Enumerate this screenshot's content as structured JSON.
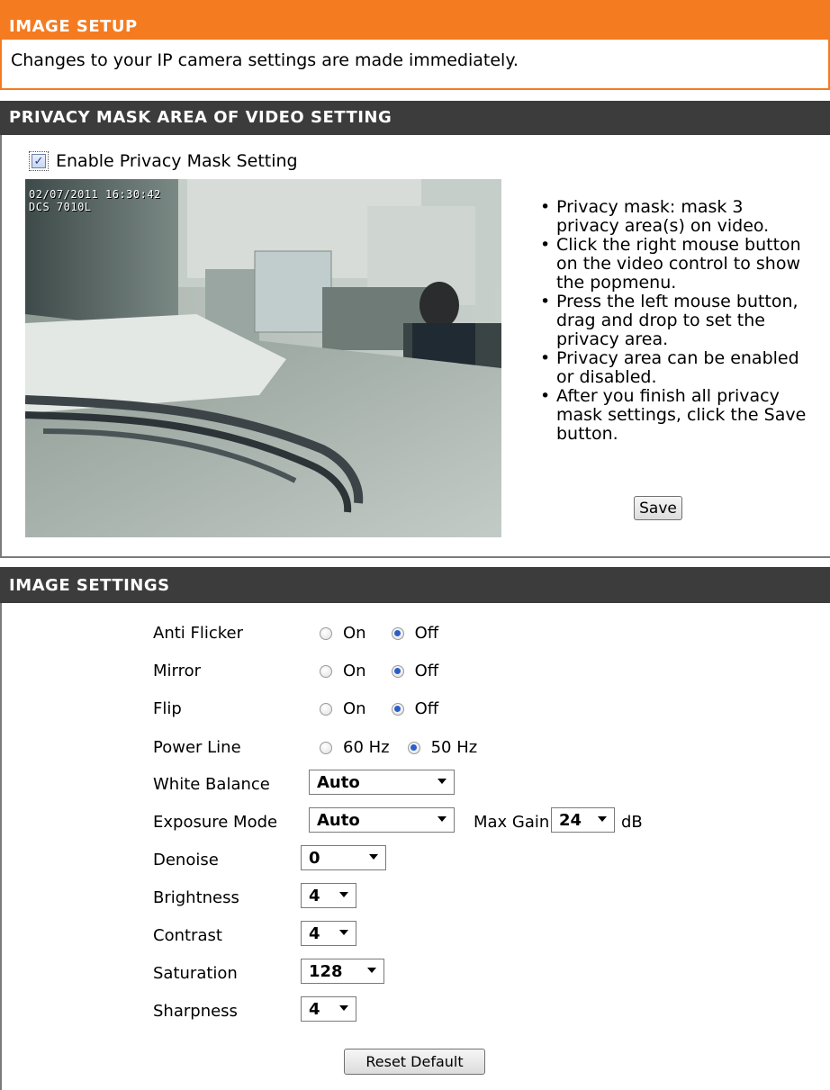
{
  "image_setup": {
    "title": "IMAGE SETUP",
    "description": "Changes to your IP camera settings are made immediately."
  },
  "privacy": {
    "title": "PRIVACY MASK AREA OF VIDEO SETTING",
    "enable_label": "Enable Privacy Mask Setting",
    "enable_checked": true,
    "osd_line1": "02/07/2011 16:30:42",
    "osd_line2": "DCS 7010L",
    "instructions": [
      "Privacy mask: mask 3 privacy area(s) on video.",
      "Click the right mouse button on the video control to show the popmenu.",
      "Press the left mouse button, drag and drop to set the privacy area.",
      "Privacy area can be enabled or disabled.",
      "After you finish all privacy mask settings, click the Save button."
    ],
    "save_label": "Save"
  },
  "image_settings": {
    "title": "IMAGE SETTINGS",
    "anti_flicker": {
      "label": "Anti Flicker",
      "options": [
        "On",
        "Off"
      ],
      "selected": "Off"
    },
    "mirror": {
      "label": "Mirror",
      "options": [
        "On",
        "Off"
      ],
      "selected": "Off"
    },
    "flip": {
      "label": "Flip",
      "options": [
        "On",
        "Off"
      ],
      "selected": "Off"
    },
    "power_line": {
      "label": "Power Line",
      "options": [
        "60 Hz",
        "50 Hz"
      ],
      "selected": "50 Hz"
    },
    "white_balance": {
      "label": "White Balance",
      "value": "Auto"
    },
    "exposure_mode": {
      "label": "Exposure Mode",
      "value": "Auto"
    },
    "max_gain": {
      "label": "Max Gain",
      "value": "24",
      "unit": "dB"
    },
    "denoise": {
      "label": "Denoise",
      "value": "0"
    },
    "brightness": {
      "label": "Brightness",
      "value": "4"
    },
    "contrast": {
      "label": "Contrast",
      "value": "4"
    },
    "saturation": {
      "label": "Saturation",
      "value": "128"
    },
    "sharpness": {
      "label": "Sharpness",
      "value": "4"
    },
    "reset_label": "Reset Default"
  },
  "colors": {
    "orange_header": "#f47b20",
    "dark_header": "#3c3c3c",
    "radio_selected": "#2a5fc8"
  }
}
